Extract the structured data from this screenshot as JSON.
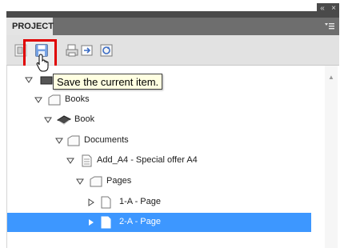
{
  "window": {
    "collapse_label": "«",
    "close_label": "×"
  },
  "panel": {
    "tab_label": "PROJECT",
    "menu_icon": "panel-menu-icon"
  },
  "toolbar": {
    "buttons": [
      {
        "name": "new-item-icon"
      },
      {
        "name": "save-icon"
      },
      {
        "name": "print-icon"
      },
      {
        "name": "export-icon"
      },
      {
        "name": "refresh-icon"
      }
    ]
  },
  "tooltip": {
    "text": "Save the current item."
  },
  "tree": {
    "rows": [
      {
        "label": "",
        "icon": "project-icon",
        "expanded": true,
        "selected": false
      },
      {
        "label": "Books",
        "icon": "folder-icon",
        "expanded": true,
        "selected": false
      },
      {
        "label": "Book",
        "icon": "book-icon",
        "expanded": true,
        "selected": false
      },
      {
        "label": "Documents",
        "icon": "folder-icon",
        "expanded": true,
        "selected": false
      },
      {
        "label": "Add_A4 - Special offer A4",
        "icon": "document-icon",
        "expanded": true,
        "selected": false
      },
      {
        "label": "Pages",
        "icon": "folder-icon",
        "expanded": true,
        "selected": false
      },
      {
        "label": "1-A - Page",
        "icon": "page-icon",
        "expanded": false,
        "selected": false
      },
      {
        "label": "2-A - Page",
        "icon": "page-icon",
        "expanded": false,
        "selected": true
      }
    ]
  },
  "colors": {
    "selection": "#3d97ff",
    "highlight_box": "#e00000",
    "tooltip_bg": "#ffffe1"
  }
}
